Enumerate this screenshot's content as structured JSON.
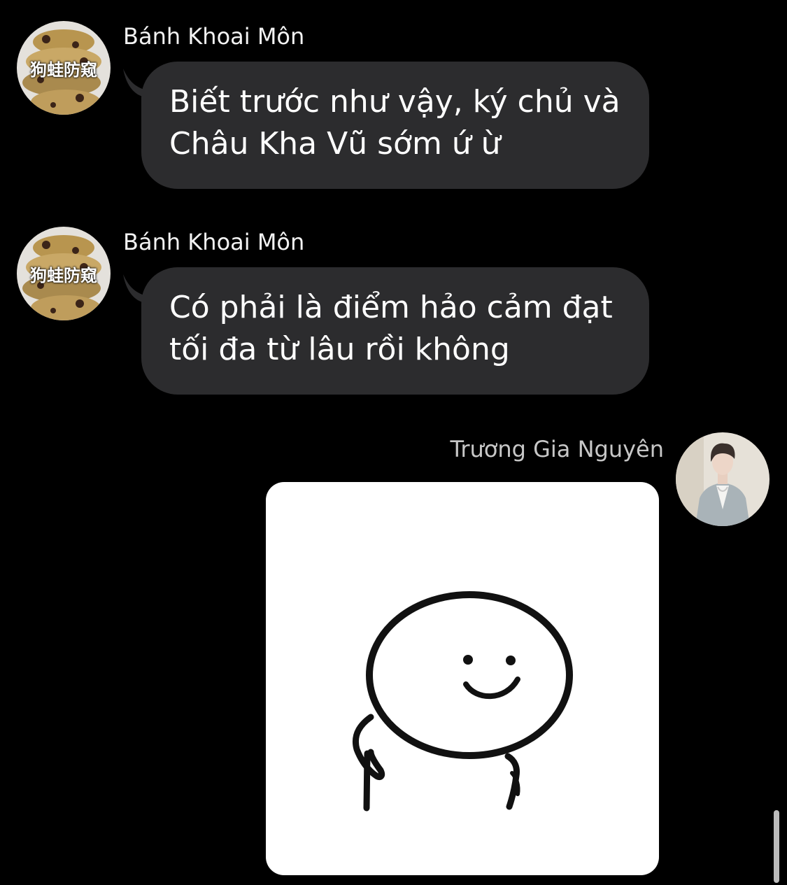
{
  "messages": [
    {
      "sender": "Bánh Khoai Môn",
      "lines": [
        "Biết trước như vậy, ký chủ và",
        "Châu Kha Vũ sớm ứ ừ"
      ]
    },
    {
      "sender": "Bánh Khoai Môn",
      "lines": [
        "Có phải là điểm hảo cảm đạt",
        "tối đa từ lâu rồi không"
      ]
    },
    {
      "sender": "Trương Gia Nguyên",
      "type": "sticker",
      "sticker_icon": "smiling-face-sticker"
    }
  ],
  "avatar_watermark": "狗蛙防窥",
  "colors": {
    "background": "#000000",
    "bubble": "#2c2c2e",
    "sticker_background": "#ffffff"
  }
}
